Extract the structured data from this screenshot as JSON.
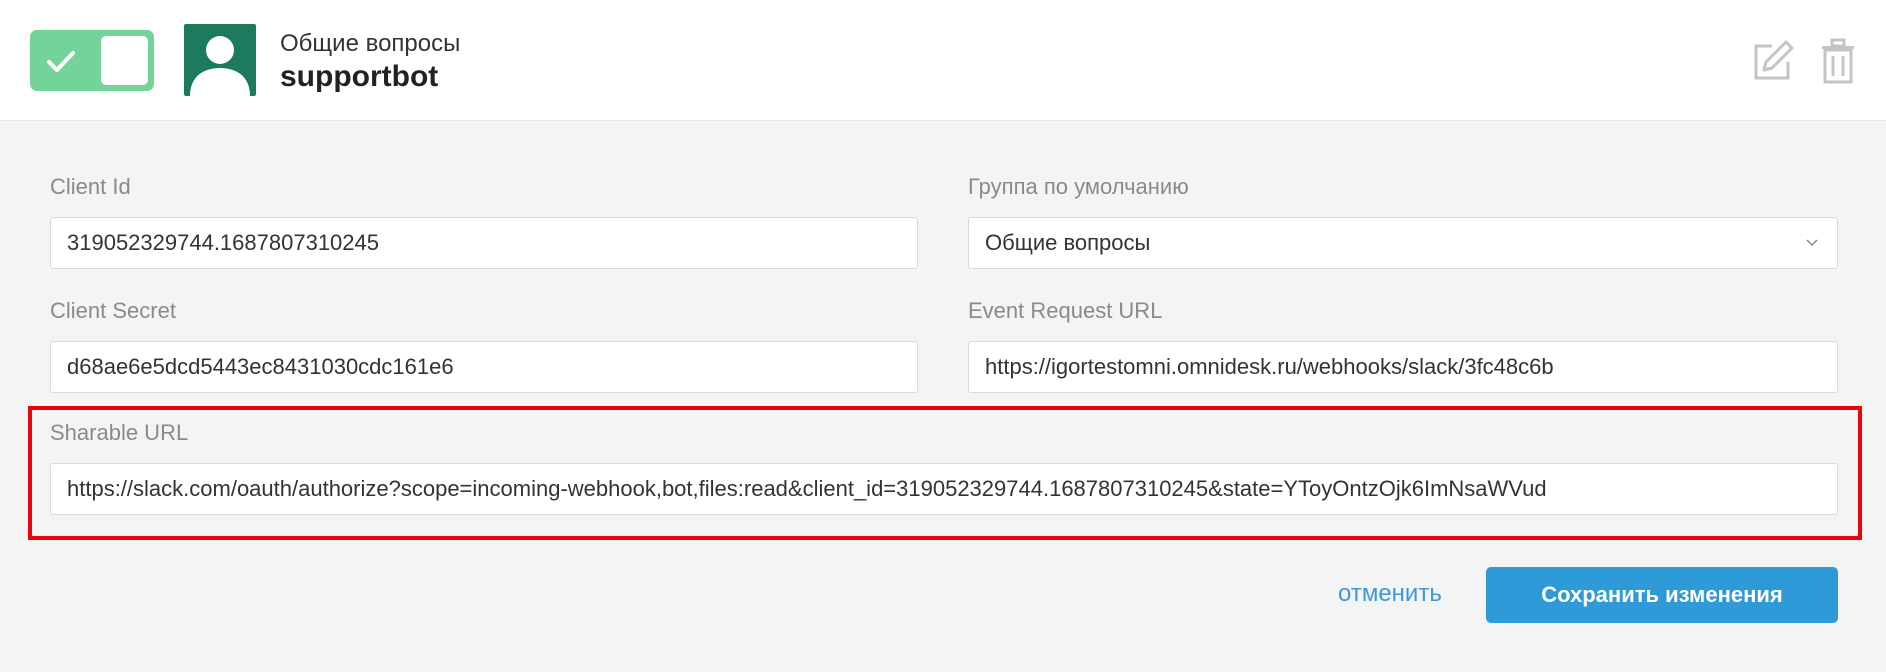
{
  "header": {
    "enabled": true,
    "group_name": "Общие вопросы",
    "bot_name": "supportbot"
  },
  "form": {
    "client_id": {
      "label": "Client Id",
      "value": "319052329744.1687807310245"
    },
    "default_group": {
      "label": "Группа по умолчанию",
      "value": "Общие вопросы"
    },
    "client_secret": {
      "label": "Client Secret",
      "value": "d68ae6e5dcd5443ec8431030cdc161e6"
    },
    "event_request_url": {
      "label": "Event Request URL",
      "value": "https://igortestomni.omnidesk.ru/webhooks/slack/3fc48c6b"
    },
    "sharable_url": {
      "label": "Sharable URL",
      "value": "https://slack.com/oauth/authorize?scope=incoming-webhook,bot,files:read&client_id=319052329744.1687807310245&state=YToyOntzOjk6ImNsaWVud"
    }
  },
  "actions": {
    "cancel_label": "отменить",
    "save_label": "Сохранить изменения"
  },
  "colors": {
    "toggle_on": "#74d398",
    "avatar_bg": "#1c7a5e",
    "primary": "#2e9ad8",
    "link": "#3a9ad9",
    "highlight": "#e8060c"
  },
  "icons": [
    "check-icon",
    "user-icon",
    "edit-icon",
    "trash-icon",
    "chevron-down-icon"
  ]
}
